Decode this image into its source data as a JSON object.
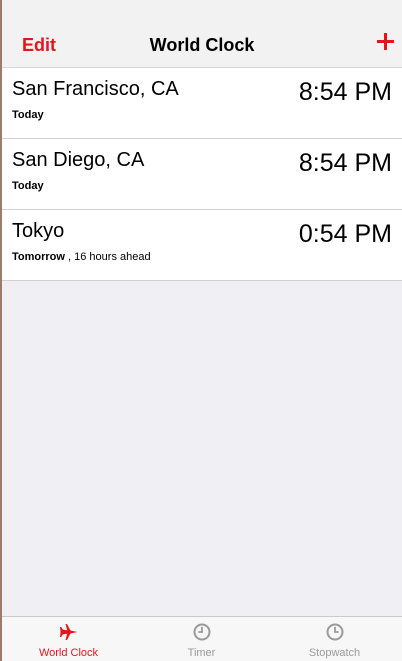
{
  "nav": {
    "edit_label": "Edit",
    "title": "World Clock",
    "add_icon": "plus-icon"
  },
  "clocks": [
    {
      "city": "San Francisco, CA",
      "day": "Today",
      "offset": "",
      "time": "8:54 PM"
    },
    {
      "city": "San Diego, CA",
      "day": "Today",
      "offset": "",
      "time": "8:54 PM"
    },
    {
      "city": "Tokyo",
      "day": "Tomorrow",
      "offset": " , 16 hours ahead",
      "time": "0:54 PM"
    }
  ],
  "tabs": [
    {
      "label": "World Clock",
      "icon": "airplane-icon",
      "active": true
    },
    {
      "label": "Timer",
      "icon": "clock-icon",
      "active": false
    },
    {
      "label": "Stopwatch",
      "icon": "clock-icon",
      "active": false
    }
  ],
  "colors": {
    "accent": "#e8141c",
    "inactive": "#9a9a9a"
  }
}
